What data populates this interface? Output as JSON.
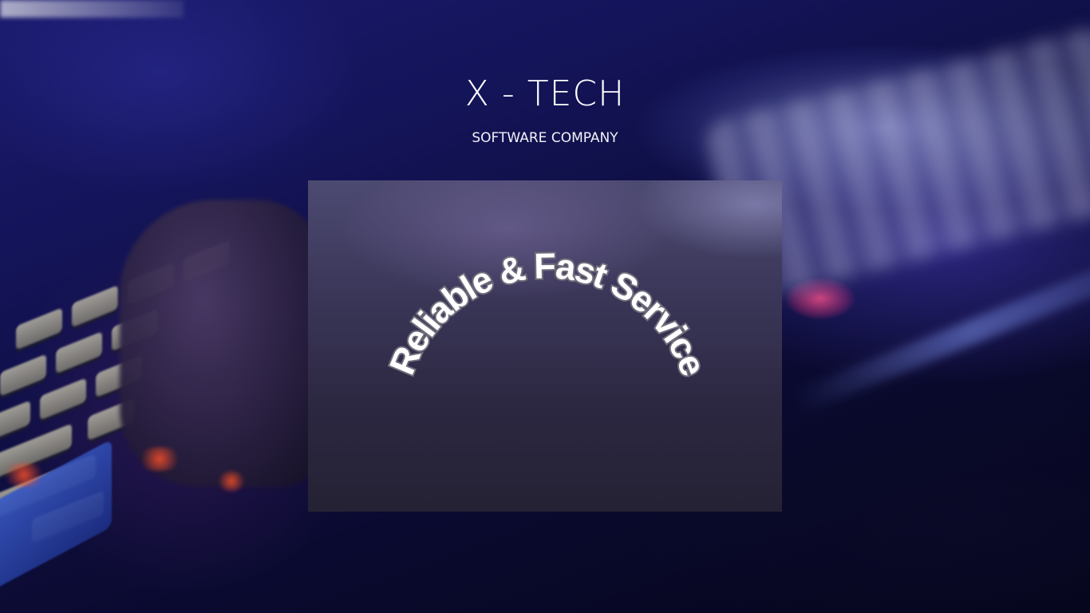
{
  "header": {
    "title": "X - TECH",
    "subtitle": "SOFTWARE COMPANY"
  },
  "card": {
    "tagline": "Reliable & Fast Service"
  },
  "colors": {
    "background": "#0c0c38",
    "card": "#2b2740",
    "text": "#ffffff",
    "tagline_outline": "#6f6d7a"
  }
}
